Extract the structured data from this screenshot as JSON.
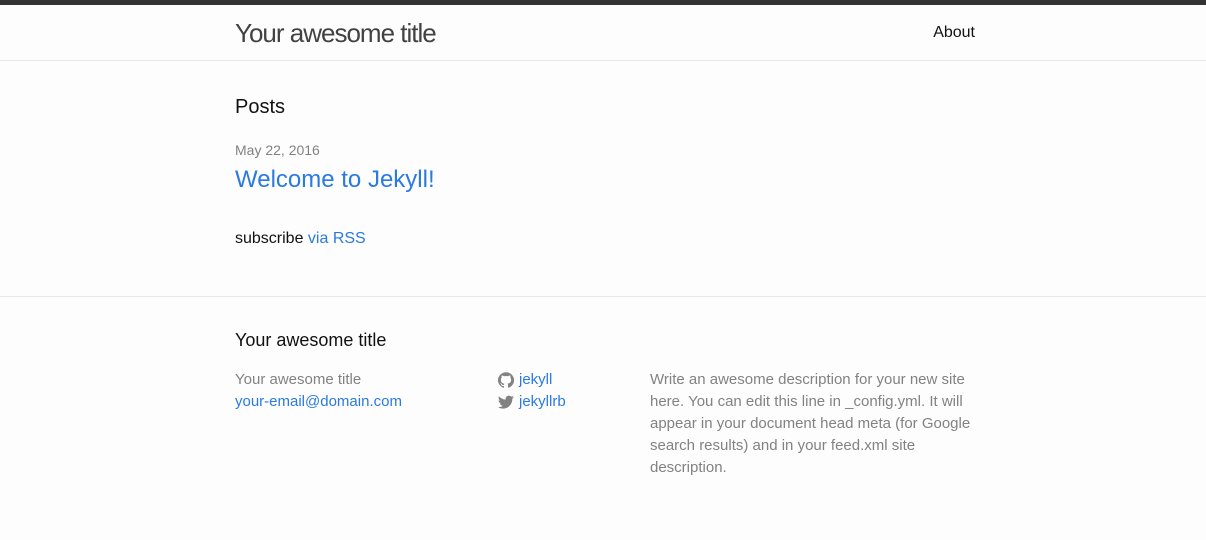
{
  "header": {
    "site_title": "Your awesome title",
    "nav": [
      {
        "label": "About"
      }
    ]
  },
  "main": {
    "heading": "Posts",
    "posts": [
      {
        "date": "May 22, 2016",
        "title": "Welcome to Jekyll!"
      }
    ],
    "subscribe_text": "subscribe ",
    "rss_link": "via RSS"
  },
  "footer": {
    "heading": "Your awesome title",
    "contact_name": "Your awesome title",
    "email": "your-email@domain.com",
    "github": {
      "icon": "github-icon",
      "username": "jekyll"
    },
    "twitter": {
      "icon": "twitter-icon",
      "username": "jekyllrb"
    },
    "description": "Write an awesome description for your new site here. You can edit this line in _config.yml. It will appear in your document head meta (for Google search results) and in your feed.xml site description."
  },
  "colors": {
    "link": "#2a7ae2",
    "muted": "#828282",
    "top_bar": "#333333",
    "border": "#e8e8e8"
  }
}
